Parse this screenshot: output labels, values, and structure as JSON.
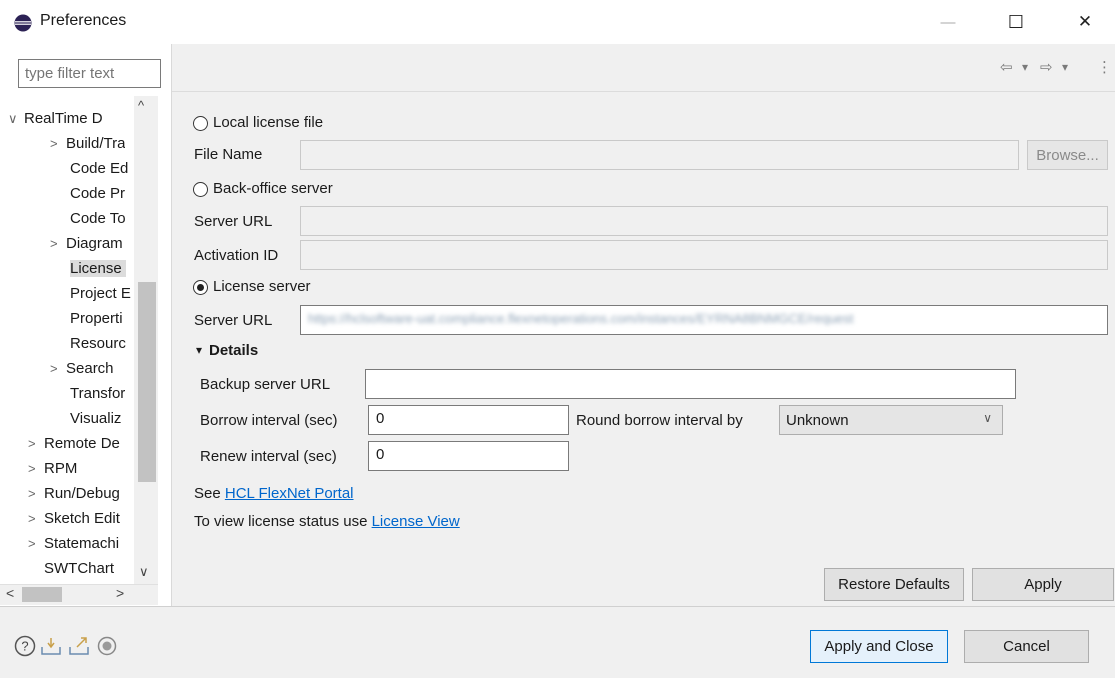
{
  "window": {
    "title": "Preferences",
    "minimize": "—",
    "maximize": "☐",
    "close": "✕"
  },
  "sidebar": {
    "filter_placeholder": "type filter text",
    "items": [
      {
        "label": "RealTime D",
        "arrow": "∨",
        "level": 0
      },
      {
        "label": "Build/Tra",
        "arrow": ">",
        "level": 1
      },
      {
        "label": "Code Ed",
        "arrow": "",
        "level": 1
      },
      {
        "label": "Code Pr",
        "arrow": "",
        "level": 1
      },
      {
        "label": "Code To",
        "arrow": "",
        "level": 1
      },
      {
        "label": "Diagram",
        "arrow": ">",
        "level": 1
      },
      {
        "label": "License",
        "arrow": "",
        "level": 1,
        "selected": true
      },
      {
        "label": "Project E",
        "arrow": "",
        "level": 1
      },
      {
        "label": "Properti",
        "arrow": "",
        "level": 1
      },
      {
        "label": "Resourc",
        "arrow": "",
        "level": 1
      },
      {
        "label": "Search",
        "arrow": ">",
        "level": 1
      },
      {
        "label": "Transfor",
        "arrow": "",
        "level": 1
      },
      {
        "label": "Visualiz",
        "arrow": "",
        "level": 1
      },
      {
        "label": "Remote De",
        "arrow": ">",
        "level": 0
      },
      {
        "label": "RPM",
        "arrow": ">",
        "level": 0
      },
      {
        "label": "Run/Debug",
        "arrow": ">",
        "level": 0
      },
      {
        "label": "Sketch Edit",
        "arrow": ">",
        "level": 0
      },
      {
        "label": "Statemachi",
        "arrow": ">",
        "level": 0
      },
      {
        "label": "SWTChart",
        "arrow": "",
        "level": 0
      }
    ],
    "scroll_up": "^",
    "scroll_down": "∨",
    "scroll_left": "<",
    "scroll_right": ">"
  },
  "toolbar": {
    "back": "⇦",
    "back_menu": "▾",
    "forward": "⇨",
    "forward_menu": "▾",
    "more": "⋮"
  },
  "license": {
    "local_file_label": "Local license file",
    "file_name_label": "File Name",
    "file_name_value": "",
    "browse_label": "Browse...",
    "backoffice_label": "Back-office server",
    "backoffice_url_label": "Server URL",
    "backoffice_url_value": "",
    "activation_id_label": "Activation ID",
    "activation_id_value": "",
    "license_server_label": "License server",
    "license_server_url_label": "Server URL",
    "license_server_url_value": "https://hclsoftware-uat.compliance.flexnetoperations.com/instances/EYRNA8BNMGCE/request",
    "selected_option": "license_server"
  },
  "details": {
    "toggle": "▾",
    "title": "Details",
    "backup_url_label": "Backup server URL",
    "backup_url_value": "",
    "borrow_label": "Borrow interval (sec)",
    "borrow_value": "0",
    "round_label": "Round borrow interval by",
    "round_value": "Unknown",
    "round_chevron": "∨",
    "renew_label": "Renew interval (sec)",
    "renew_value": "0"
  },
  "links": {
    "see_prefix": "See ",
    "flexnet": "HCL FlexNet Portal",
    "status_prefix": "To view license status use ",
    "license_view": "License View"
  },
  "buttons": {
    "restore_defaults": "Restore Defaults",
    "apply": "Apply",
    "apply_close": "Apply and Close",
    "cancel": "Cancel"
  },
  "footer": {
    "icons": [
      "help-icon",
      "import-icon",
      "export-icon",
      "record-icon"
    ]
  }
}
